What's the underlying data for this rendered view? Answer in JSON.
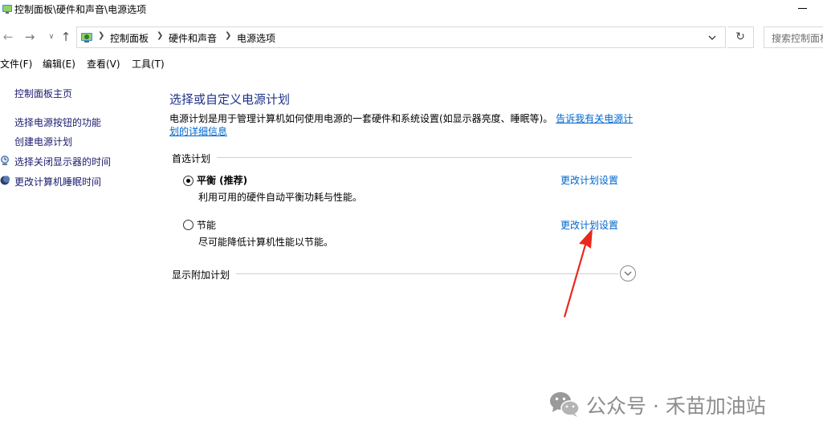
{
  "window": {
    "title": "控制面板\\硬件和声音\\电源选项"
  },
  "address_bar": {
    "breadcrumbs": [
      "控制面板",
      "硬件和声音",
      "电源选项"
    ],
    "search_placeholder": "搜索控制面板"
  },
  "menu": {
    "items": [
      "文件(F)",
      "编辑(E)",
      "查看(V)",
      "工具(T)"
    ]
  },
  "left_pane": {
    "home": "控制面板主页",
    "links": [
      "选择电源按钮的功能",
      "创建电源计划",
      "选择关闭显示器的时间",
      "更改计算机睡眠时间"
    ]
  },
  "main": {
    "title": "选择或自定义电源计划",
    "description": "电源计划是用于管理计算机如何使用电源的一套硬件和系统设置(如显示器亮度、睡眠等)。",
    "learn_more_link": "告诉我有关电源计划的详细信息",
    "preferred_section": "首选计划",
    "plans": [
      {
        "name": "平衡 (推荐)",
        "description": "利用可用的硬件自动平衡功耗与性能。",
        "change_link": "更改计划设置",
        "selected": true
      },
      {
        "name": "节能",
        "description": "尽可能降低计算机性能以节能。",
        "change_link": "更改计划设置",
        "selected": false
      }
    ],
    "additional_section": "显示附加计划"
  },
  "watermark": {
    "text": "公众号 · 禾苗加油站"
  },
  "icons": {
    "title": "control-panel-icon",
    "address": "control-panel-icon",
    "left_display": "monitor-clock-icon",
    "left_sleep": "moon-icon",
    "expand": "chevron-down-icon",
    "watermark": "wechat-icon"
  },
  "colors": {
    "link": "#0066cc",
    "title": "#1e3287",
    "annotation_arrow": "#e8281e"
  }
}
